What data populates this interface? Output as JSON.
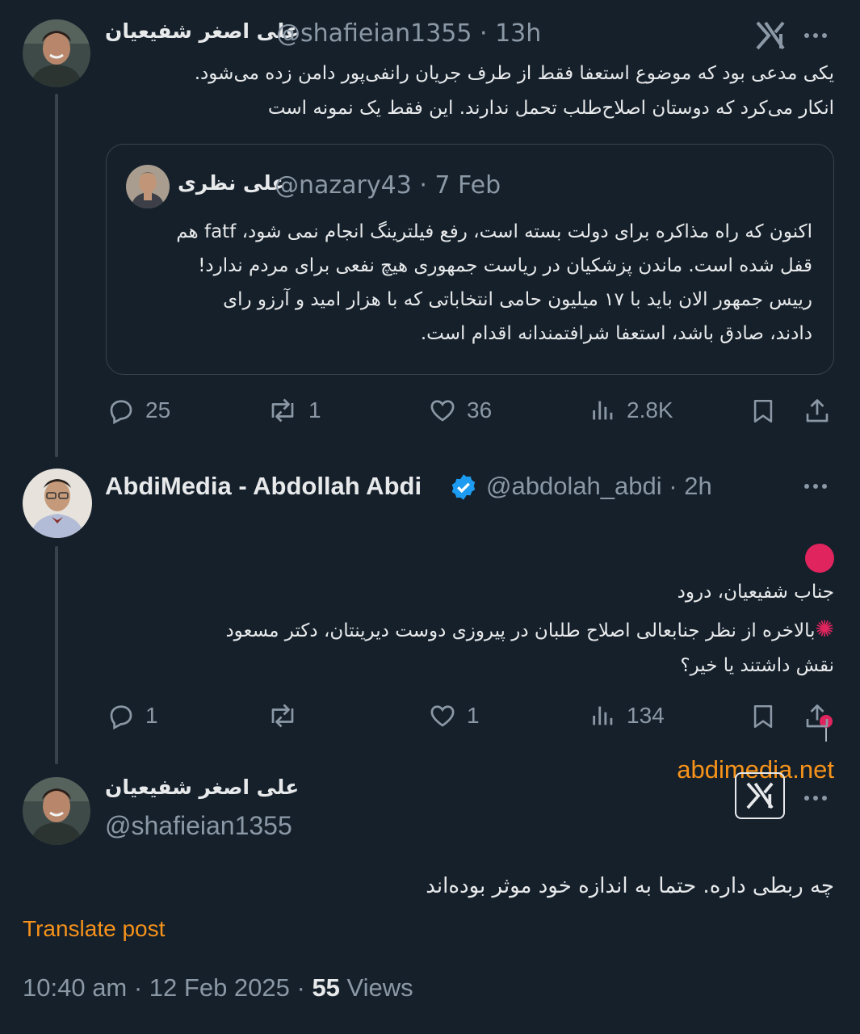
{
  "tweet1": {
    "name": "علی اصغر شفیعیان",
    "handle": "@shafieian1355",
    "time": "13h",
    "text": "یکی مدعی بود که موضوع استعفا فقط از طرف جریان رانفی‌پور دامن زده می‌شود.\nانکار می‌کرد که دوستان اصلاح‌طلب تحمل ندارند. این فقط یک نمونه است",
    "quote": {
      "name": "علی نظری",
      "handle": "@nazary43",
      "time": "7 Feb",
      "text": "اکنون که راه مذاکره برای دولت بسته است، رفع فیلترینگ انجام نمی شود، fatf هم\nقفل شده است. ماندن پزشکیان در ریاست جمهوری هیچ نفعی برای مردم ندارد!\nرییس جمهور الان باید با ۱۷ میلیون حامی انتخاباتی که با هزار امید و آرزو رای\nدادند، صادق باشد، استعفا شرافتمندانه اقدام است."
    },
    "replies": "25",
    "reposts": "1",
    "likes": "36",
    "views": "2.8K"
  },
  "tweet2": {
    "name": "AbdiMedia - Abdollah Abdi",
    "handle": "@abdolah_abdi",
    "time": "2h",
    "line1": "جناب شفیعیان، درود",
    "line2": "بالاخره از نظر جنابعالی اصلاح طلبان در پیروزی دوست دیرینتان، دکتر مسعود\nنقش داشتند یا خیر؟",
    "link": "abdimedia.net",
    "replies": "1",
    "reposts": "",
    "likes": "1",
    "views": "134"
  },
  "tweet3": {
    "name": "علی اصغر شفیعیان",
    "handle": "@shafieian1355",
    "text": "چه ربطی داره. حتما به اندازه خود موثر بوده‌اند",
    "translate": "Translate post",
    "timestamp": "10:40 am · 12 Feb 2025 · ",
    "views_count": "55",
    "views_label": " Views"
  },
  "colors": {
    "background": "#15202b",
    "text": "#e7e9ea",
    "muted": "#8b98a5",
    "accent": "#f7931a",
    "verified": "#1d9bf0",
    "red": "#e0245e"
  },
  "icons": [
    "more-icon",
    "grok-icon",
    "reply-icon",
    "repost-icon",
    "like-icon",
    "views-icon",
    "bookmark-icon",
    "share-icon",
    "verified-icon"
  ]
}
